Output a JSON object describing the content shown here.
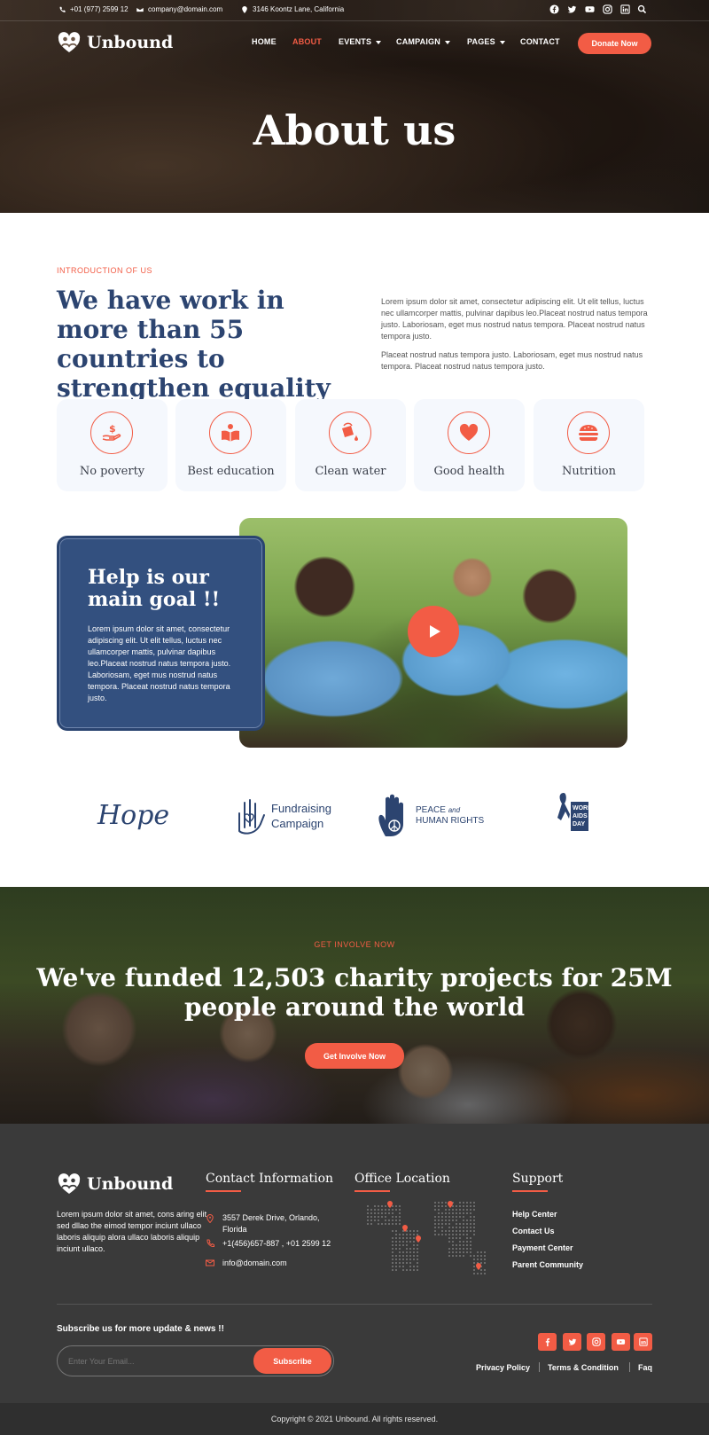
{
  "topbar": {
    "phone": "+01 (977) 2599 12",
    "email": "company@domain.com",
    "address": "3146 Koontz Lane, California",
    "social": [
      "facebook-icon",
      "twitter-icon",
      "youtube-icon",
      "instagram-icon",
      "linkedin-icon",
      "search-icon"
    ]
  },
  "brand": {
    "name": "Unbound",
    "accent": "#f25c45",
    "navy": "#2c4470"
  },
  "nav": {
    "items": [
      {
        "label": "HOME",
        "dropdown": false
      },
      {
        "label": "ABOUT",
        "dropdown": false,
        "active": true
      },
      {
        "label": "EVENTS",
        "dropdown": true
      },
      {
        "label": "CAMPAIGN",
        "dropdown": true
      },
      {
        "label": "PAGES",
        "dropdown": true
      },
      {
        "label": "CONTACT",
        "dropdown": false
      }
    ],
    "donate": "Donate Now"
  },
  "hero": {
    "title": "About us"
  },
  "intro": {
    "eyebrow": "INTRODUCTION OF US",
    "heading": "We have work in more than 55 countries to strengthen equality",
    "p1": "Lorem ipsum dolor sit amet, consectetur adipiscing elit. Ut elit tellus, luctus nec ullamcorper mattis, pulvinar dapibus leo.Placeat nostrud natus tempora justo. Laboriosam, eget mus nostrud natus tempora. Placeat nostrud natus tempora justo.",
    "p2": "Placeat nostrud natus tempora justo. Laboriosam, eget mus nostrud natus tempora. Placeat nostrud natus tempora justo."
  },
  "causes": [
    {
      "label": "No poverty",
      "icon": "donation-hand-icon"
    },
    {
      "label": "Best education",
      "icon": "book-icon"
    },
    {
      "label": "Clean water",
      "icon": "water-bucket-icon"
    },
    {
      "label": "Good health",
      "icon": "heart-icon"
    },
    {
      "label": "Nutrition",
      "icon": "burger-icon"
    }
  ],
  "help": {
    "heading": "Help is our main goal !!",
    "text": "Lorem ipsum dolor sit amet, consectetur adipiscing elit. Ut elit tellus, luctus nec ullamcorper mattis, pulvinar dapibus leo.Placeat nostrud natus tempora justo. Laboriosam, eget mus nostrud natus tempora. Placeat nostrud natus tempora justo."
  },
  "partners": {
    "hope": "Hope",
    "fundraising_1": "Fundraising",
    "fundraising_2": "Campaign",
    "peace_1": "PEACE",
    "peace_and": "and",
    "peace_2": "HUMAN RIGHTS",
    "aids_1": "WORLD",
    "aids_2": "AIDS",
    "aids_3": "DAY"
  },
  "cta": {
    "eyebrow": "GET INVOLVE NOW",
    "heading": "We've funded 12,503 charity projects for 25M people around the world",
    "button": "Get Involve Now"
  },
  "footer": {
    "about": "Lorem ipsum dolor sit amet, cons aring elit sed dllao the eimod tempor inciunt ullaco laboris aliquip alora ullaco laboris aliquip inciunt ullaco.",
    "contact_title": "Contact Information",
    "contact_address": "3557 Derek Drive, Orlando, Florida",
    "contact_phone": "+1(456)657-887 , +01 2599 12",
    "contact_email": "info@domain.com",
    "office_title": "Office Location",
    "support_title": "Support",
    "support_links": [
      "Help Center",
      "Contact Us",
      "Payment Center",
      "Parent Community"
    ],
    "subscribe_title": "Subscribe us for more update & news !!",
    "subscribe_placeholder": "Enter Your Email...",
    "subscribe_button": "Subscribe",
    "legal_links": [
      "Privacy Policy",
      "Terms & Condition",
      "Faq"
    ],
    "copyright": "Copyright © 2021 Unbound. All rights reserved."
  }
}
